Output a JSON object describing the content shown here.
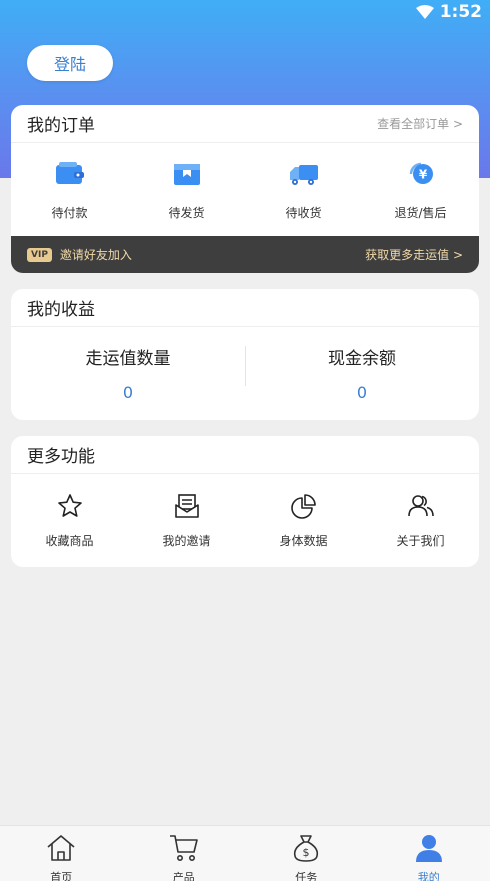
{
  "status_bar": {
    "time": "1:52"
  },
  "login_button": "登陆",
  "orders": {
    "title": "我的订单",
    "view_all": "查看全部订单 >",
    "items": [
      {
        "label": "待付款",
        "icon": "wallet-icon"
      },
      {
        "label": "待发货",
        "icon": "package-icon"
      },
      {
        "label": "待收货",
        "icon": "truck-icon"
      },
      {
        "label": "退货/售后",
        "icon": "refund-icon"
      }
    ],
    "vip": {
      "badge": "VIP",
      "invite": "邀请好友加入",
      "more_link": "获取更多走运值 >"
    }
  },
  "earnings": {
    "title": "我的收益",
    "items": [
      {
        "label": "走运值数量",
        "value": "0"
      },
      {
        "label": "现金余额",
        "value": "0"
      }
    ]
  },
  "more": {
    "title": "更多功能",
    "items": [
      {
        "label": "收藏商品",
        "icon": "star-icon"
      },
      {
        "label": "我的邀请",
        "icon": "invitation-icon"
      },
      {
        "label": "身体数据",
        "icon": "pie-chart-icon"
      },
      {
        "label": "关于我们",
        "icon": "users-icon"
      }
    ]
  },
  "tabs": [
    {
      "label": "首页",
      "icon": "home-icon",
      "active": false
    },
    {
      "label": "产品",
      "icon": "cart-icon",
      "active": false
    },
    {
      "label": "任务",
      "icon": "money-bag-icon",
      "active": false
    },
    {
      "label": "我的",
      "icon": "person-icon",
      "active": true
    }
  ],
  "colors": {
    "accent": "#3b7fd0",
    "header_top": "#40aef6",
    "header_bottom": "#6a78ea",
    "vip_bar": "#3e3e3e",
    "vip_text": "#f1d9a8"
  }
}
